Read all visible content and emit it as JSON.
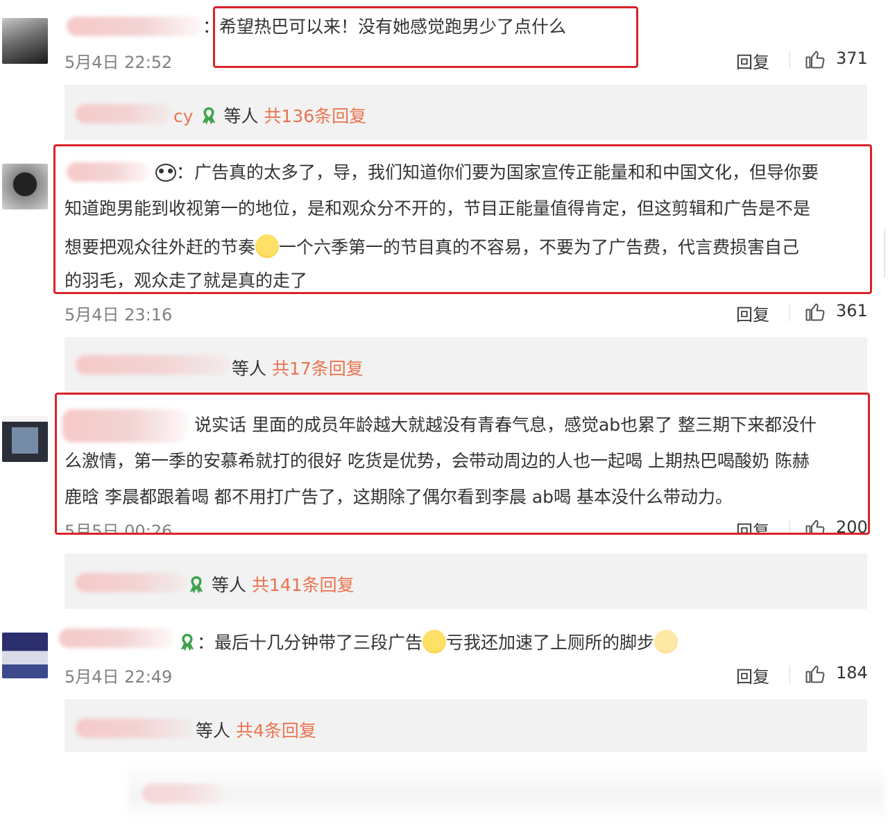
{
  "colors": {
    "highlight_box": "#d9222a",
    "reply_count": "#eb7350",
    "timestamp": "#808080",
    "sub_reply_bg": "#f2f2f2"
  },
  "comments": [
    {
      "name_suffix": "",
      "separator": "：",
      "text": "希望热巴可以来！没有她感觉跑男少了点什么",
      "time": "5月4日 22:52",
      "reply_label": "回复",
      "likes": "371",
      "sub_name_suffix": "cy",
      "sub_prefix": "等人",
      "sub_count": "共136条回复"
    },
    {
      "separator": "：",
      "text_lines": [
        "广告真的太多了，导，我们知道你们要为国家宣传正能量和和中国文化，但导你要",
        "知道跑男能到收视第一的地位，是和观众分不开的，节目正能量值得肯定，但这剪辑和广告是不是",
        "想要把观众往外赶的节奏",
        "一个六季第一的节目真的不容易，不要为了广告费，代言费损害自己",
        "的羽毛，观众走了就是真的走了"
      ],
      "time": "5月4日 23:16",
      "reply_label": "回复",
      "likes": "361",
      "sub_prefix": "等人",
      "sub_count": "共17条回复"
    },
    {
      "text_lines": [
        "说实话 里面的成员年龄越大就越没有青春气息，感觉ab也累了 整三期下来都没什",
        "么激情，第一季的安慕希就打的很好 吃货是优势，会带动周边的人也一起喝 上期热巴喝酸奶 陈赫",
        "鹿晗 李晨都跟着喝 都不用打广告了，这期除了偶尔看到李晨 ab喝 基本没什么带动力。"
      ],
      "time": "5月5日 00:26",
      "reply_label": "回复",
      "likes": "200",
      "sub_prefix": "等人",
      "sub_count": "共141条回复"
    },
    {
      "separator": "：",
      "text_a": "最后十几分钟带了三段广告",
      "text_b": "亏我还加速了上厕所的脚步",
      "time": "5月4日 22:49",
      "reply_label": "回复",
      "likes": "184",
      "sub_prefix": "等人",
      "sub_count": "共4条回复"
    }
  ],
  "icons": {
    "like": "thumbs-up-icon",
    "badge": "green-ribbon-icon",
    "panda": "panda-emoji-icon",
    "cry": "crying-face-emoji-icon",
    "laugh": "laughing-tears-emoji-icon",
    "cat": "cat-face-emoji-icon"
  }
}
